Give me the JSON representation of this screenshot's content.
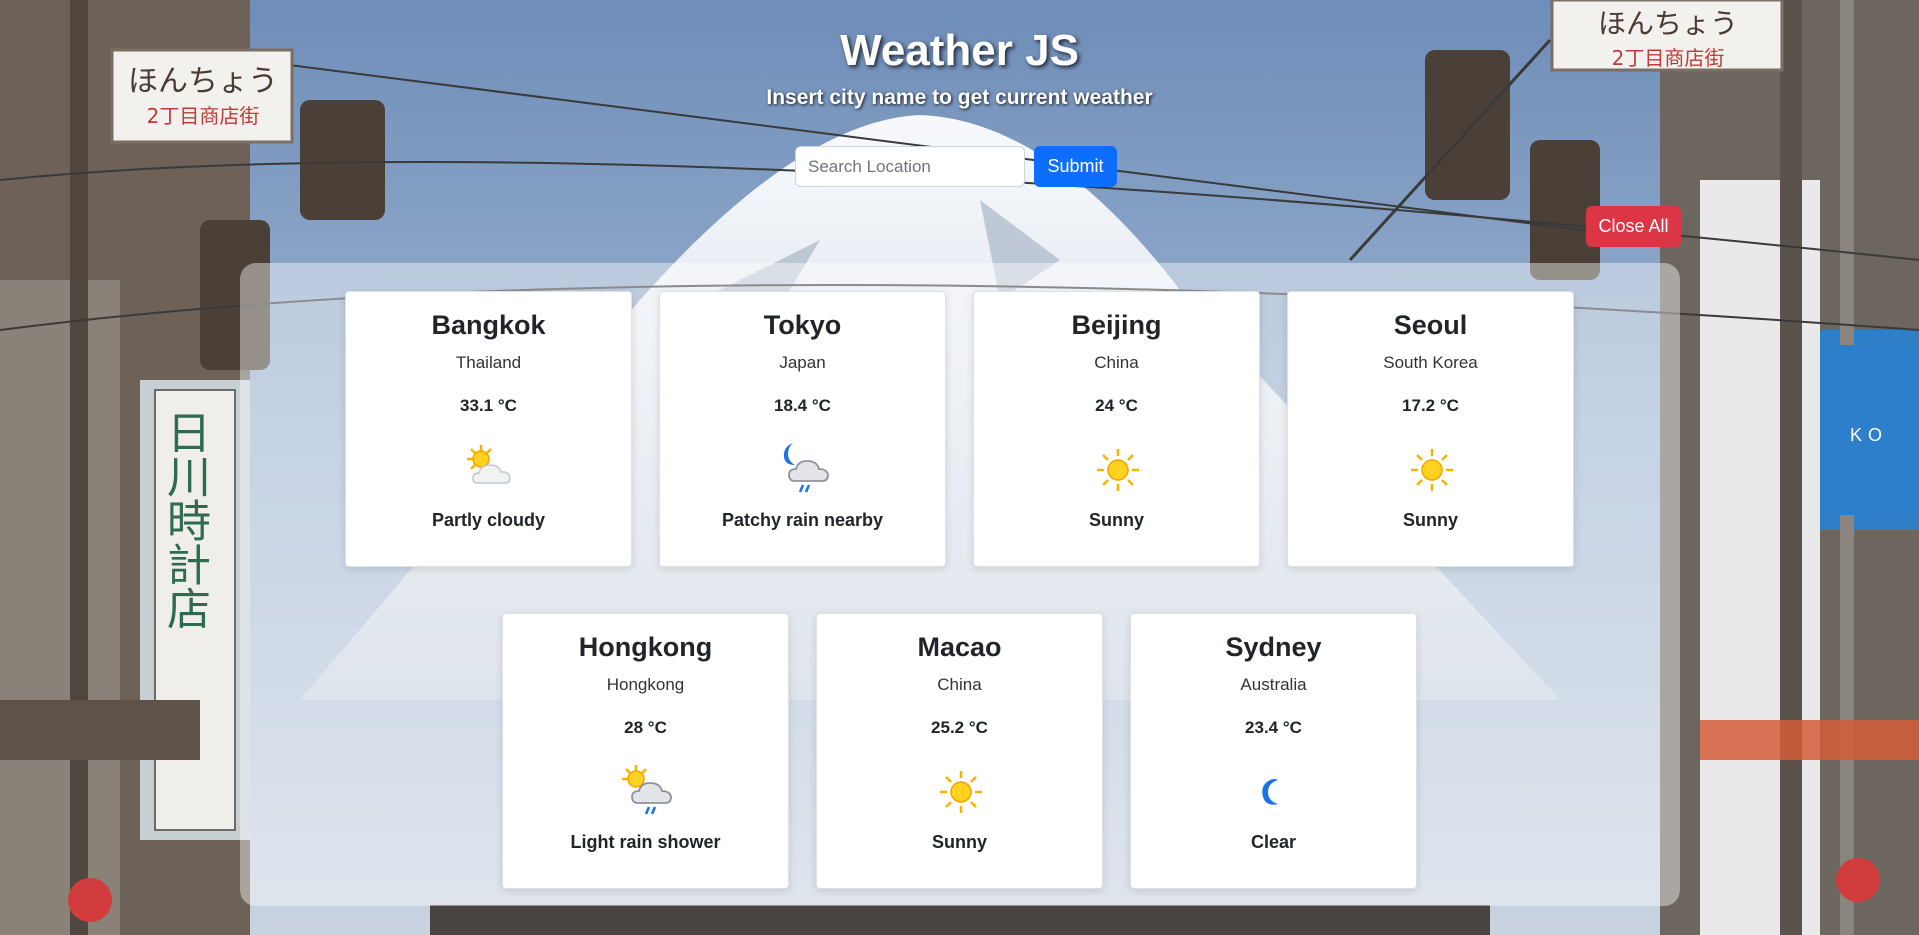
{
  "header": {
    "title": "Weather JS",
    "subtitle": "Insert city name to get current weather"
  },
  "search": {
    "placeholder": "Search Location",
    "value": "",
    "submit_label": "Submit"
  },
  "close_all_label": "Close All",
  "cards": [
    {
      "city": "Bangkok",
      "country": "Thailand",
      "temp": "33.1 °C",
      "condition": "Partly cloudy",
      "icon": "partly-cloudy-icon"
    },
    {
      "city": "Tokyo",
      "country": "Japan",
      "temp": "18.4 °C",
      "condition": "Patchy rain nearby",
      "icon": "night-rain-icon"
    },
    {
      "city": "Beijing",
      "country": "China",
      "temp": "24 °C",
      "condition": "Sunny",
      "icon": "sun-icon"
    },
    {
      "city": "Seoul",
      "country": "South Korea",
      "temp": "17.2 °C",
      "condition": "Sunny",
      "icon": "sun-icon"
    },
    {
      "city": "Hongkong",
      "country": "Hongkong",
      "temp": "28 °C",
      "condition": "Light rain shower",
      "icon": "sun-rain-icon"
    },
    {
      "city": "Macao",
      "country": "China",
      "temp": "25.2 °C",
      "condition": "Sunny",
      "icon": "sun-icon"
    },
    {
      "city": "Sydney",
      "country": "Australia",
      "temp": "23.4 °C",
      "condition": "Clear",
      "icon": "moon-icon"
    }
  ],
  "background_signs": {
    "left_sign": "ほんちょう",
    "left_sign_sub": "2丁目商店街",
    "right_sign": "ほんちょう",
    "right_sign_sub": "2丁目商店街",
    "vertical_sign": "日川時計店",
    "blue_sign": "KO"
  },
  "colors": {
    "primary": "#0d6efd",
    "danger": "#dc3545",
    "sky": "#8fa7c6"
  }
}
